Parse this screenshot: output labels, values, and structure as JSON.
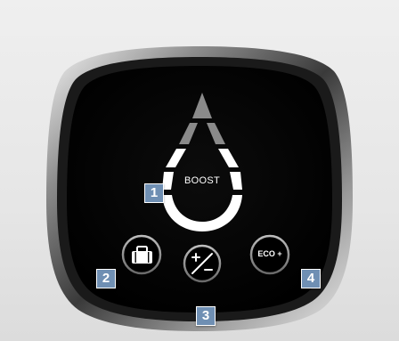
{
  "display": {
    "center_label": "BOOST",
    "plus_minus_label": "+/−",
    "eco_label": "ECO +"
  },
  "icons": {
    "luggage": "luggage-icon",
    "plus_minus": "plus-minus-icon",
    "eco": "eco-plus-icon",
    "droplet": "water-drop-icon"
  },
  "callouts": {
    "c1": "1",
    "c2": "2",
    "c3": "3",
    "c4": "4"
  },
  "colors": {
    "callout_bg": "#6f8fb3",
    "panel_face": "#050505",
    "segment_active": "#ffffff",
    "segment_dim": "#8a8a8a"
  }
}
